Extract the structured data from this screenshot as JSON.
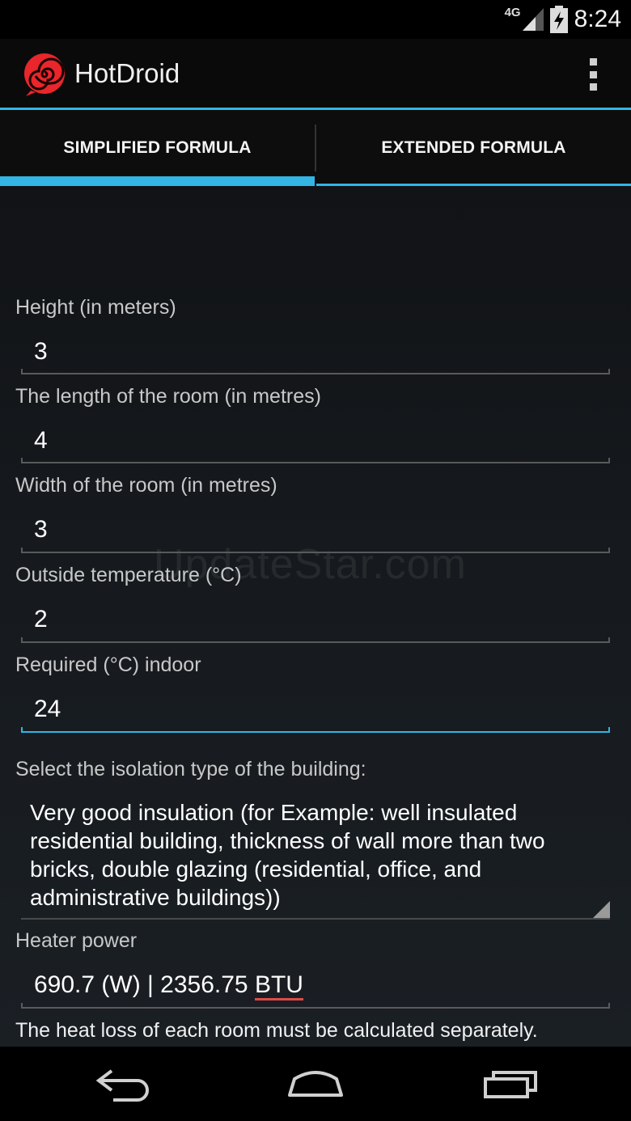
{
  "status_bar": {
    "network": "4G",
    "time": "8:24"
  },
  "app": {
    "title": "HotDroid",
    "accent": "#33b5e5",
    "icon_color": "#e8262b"
  },
  "tabs": [
    {
      "label": "SIMPLIFIED FORMULA",
      "selected": true
    },
    {
      "label": "EXTENDED FORMULA",
      "selected": false
    }
  ],
  "form": {
    "height": {
      "label": "Height (in meters)",
      "value": "3"
    },
    "length": {
      "label": "The length of the room (in metres)",
      "value": "4"
    },
    "width": {
      "label": "Width of the room (in metres)",
      "value": "3"
    },
    "outside_temp": {
      "label": "Outside temperature (°C)",
      "value": "2"
    },
    "indoor_temp": {
      "label": "Required (°C) indoor",
      "value": "24"
    },
    "isolation": {
      "label": "Select the isolation type of the building:",
      "selected": "Very good insulation (for Example: well insulated residential building, thickness of wall more than two bricks, double glazing (residential, office, and administrative buildings))"
    },
    "heater_power": {
      "label": "Heater power",
      "value_prefix": "690.7 (W) | 2356.75 ",
      "value_unit": "BTU"
    }
  },
  "note": "The heat loss of each room must be calculated separately.",
  "watermark": "UpdateStar.com",
  "nav": {
    "back_icon": "back-icon",
    "home_icon": "home-icon",
    "recents_icon": "recents-icon"
  }
}
